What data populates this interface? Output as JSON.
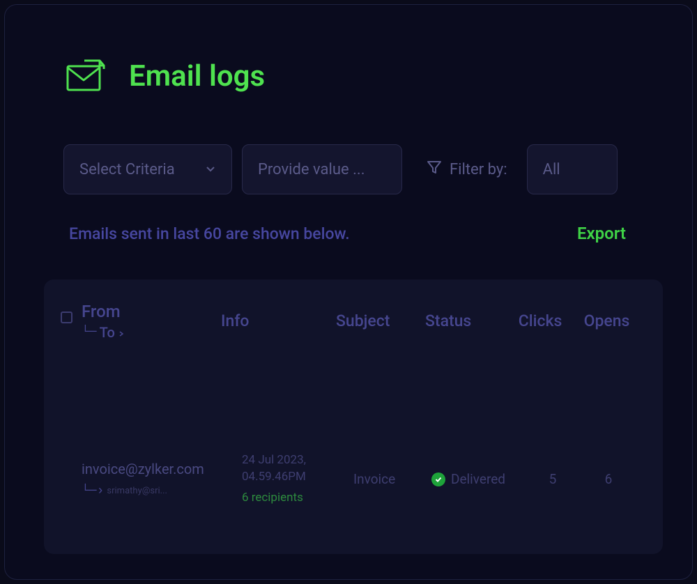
{
  "header": {
    "title": "Email logs"
  },
  "filters": {
    "criteria_placeholder": "Select Criteria",
    "value_placeholder": "Provide value ...",
    "filter_label": "Filter by:",
    "scope_selected": "All"
  },
  "info": {
    "note": "Emails sent in last 60 are shown below.",
    "export_label": "Export"
  },
  "table": {
    "headers": {
      "from": "From",
      "to": "To",
      "info": "Info",
      "subject": "Subject",
      "status": "Status",
      "clicks": "Clicks",
      "opens": "Opens"
    },
    "rows": [
      {
        "from": "invoice@zylker.com",
        "to": "srimathy@sri...",
        "date": "24 Jul 2023,",
        "time": "04.59.46PM",
        "recipients": "6 recipients",
        "subject": "Invoice",
        "status": "Delivered",
        "clicks": "5",
        "opens": "6"
      }
    ]
  }
}
